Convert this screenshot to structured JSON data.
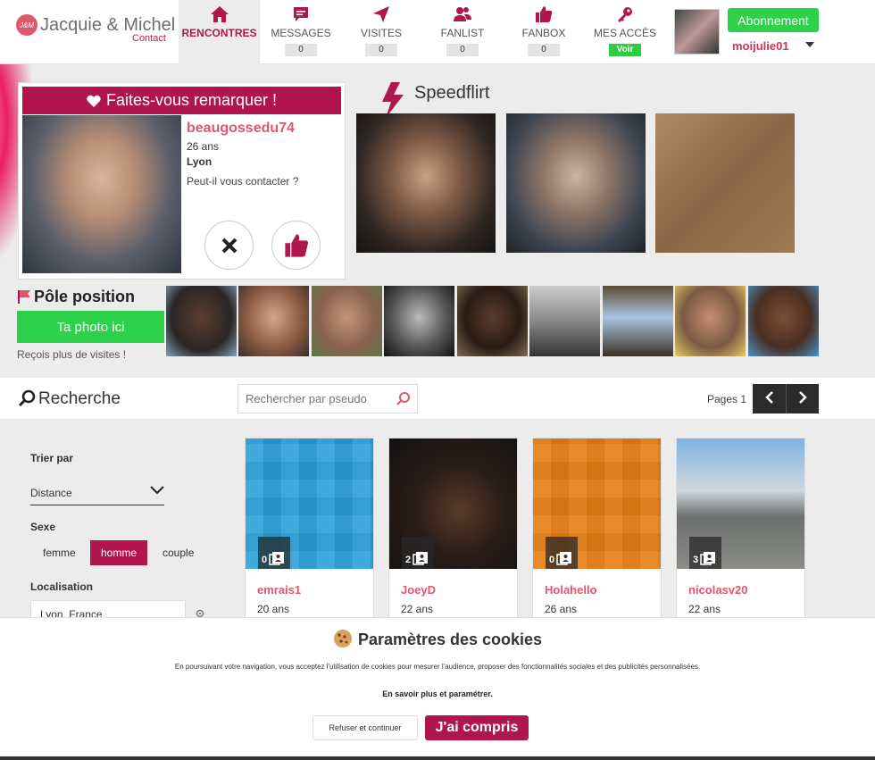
{
  "brand": {
    "name": "Jacquie & Michel",
    "sub": "Contact",
    "mark": "J&M"
  },
  "nav": [
    {
      "label": "RENCONTRES",
      "icon": "home-icon"
    },
    {
      "label": "MESSAGES",
      "icon": "chat-icon",
      "count": "0"
    },
    {
      "label": "VISITES",
      "icon": "paper-plane-icon",
      "count": "0"
    },
    {
      "label": "FANLIST",
      "icon": "users-icon",
      "count": "0"
    },
    {
      "label": "FANBOX",
      "icon": "thumbs-up-icon",
      "count": "0"
    },
    {
      "label": "MES ACCÈS",
      "icon": "key-icon",
      "count": "Voir"
    }
  ],
  "account": {
    "button": "Abonnement",
    "username": "moijulie01"
  },
  "featured": {
    "header": "Faites-vous remarquer !",
    "name": "beaugossedu74",
    "age": "26 ans",
    "city": "Lyon",
    "question": "Peut-il vous contacter ?"
  },
  "speedflirt": {
    "title": "Speedflirt"
  },
  "pole": {
    "title": "Pôle position",
    "button": "Ta photo ici",
    "subtitle": "Reçois plus de visites !"
  },
  "search": {
    "title": "Recherche",
    "placeholder": "Rechercher par pseudo",
    "pages_label": "Pages 1"
  },
  "filters": {
    "sort_label": "Trier par",
    "sort_value": "Distance",
    "sex_label": "Sexe",
    "sex_options": [
      "femme",
      "homme",
      "couple"
    ],
    "sex_selected": "homme",
    "location_label": "Localisation",
    "location_value": "Lyon, France"
  },
  "profiles": [
    {
      "name": "emrais1",
      "age": "20 ans",
      "photos": "0"
    },
    {
      "name": "JoeyD",
      "age": "22 ans",
      "photos": "2"
    },
    {
      "name": "Holahello",
      "age": "26 ans",
      "photos": "0"
    },
    {
      "name": "nicolasv20",
      "age": "22 ans",
      "photos": "3"
    }
  ],
  "cookies": {
    "title": "Paramètres des cookies",
    "text": "En poursuivant votre navigation, vous acceptez l'utilisation de cookies pour mesurer l'audience, proposer des fonctionnalités sociales et des publicités personnalisées.",
    "more": "En savoir plus et paramétrer.",
    "refuse": "Refuser et continuer",
    "accept": "J'ai compris"
  },
  "colors": {
    "brand": "#b0154e",
    "accent_green": "#2ed14a",
    "name_pink": "#e0566d"
  }
}
